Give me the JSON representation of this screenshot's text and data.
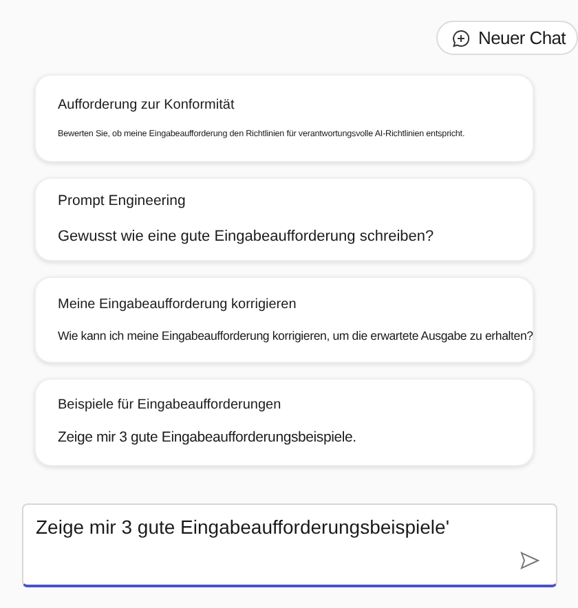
{
  "new_chat_button": {
    "label": "Neuer Chat"
  },
  "suggestions": [
    {
      "title": "Aufforderung zur Konformität",
      "text": "Bewerten Sie, ob meine Eingabeaufforderung den Richtlinien für verantwortungsvolle AI-Richtlinien entspricht."
    },
    {
      "title": "Prompt Engineering",
      "text": "Gewusst wie eine gute Eingabeaufforderung schreiben?"
    },
    {
      "title": "Meine Eingabeaufforderung korrigieren",
      "text": "Wie kann ich meine Eingabeaufforderung korrigieren, um die erwartete Ausgabe zu erhalten?"
    },
    {
      "title": "Beispiele für Eingabeaufforderungen",
      "text": "Zeige mir 3 gute Eingabeaufforderungsbeispiele."
    }
  ],
  "prompt_input": {
    "value": "Zeige mir 3 gute Eingabeaufforderungsbeispiele'"
  }
}
